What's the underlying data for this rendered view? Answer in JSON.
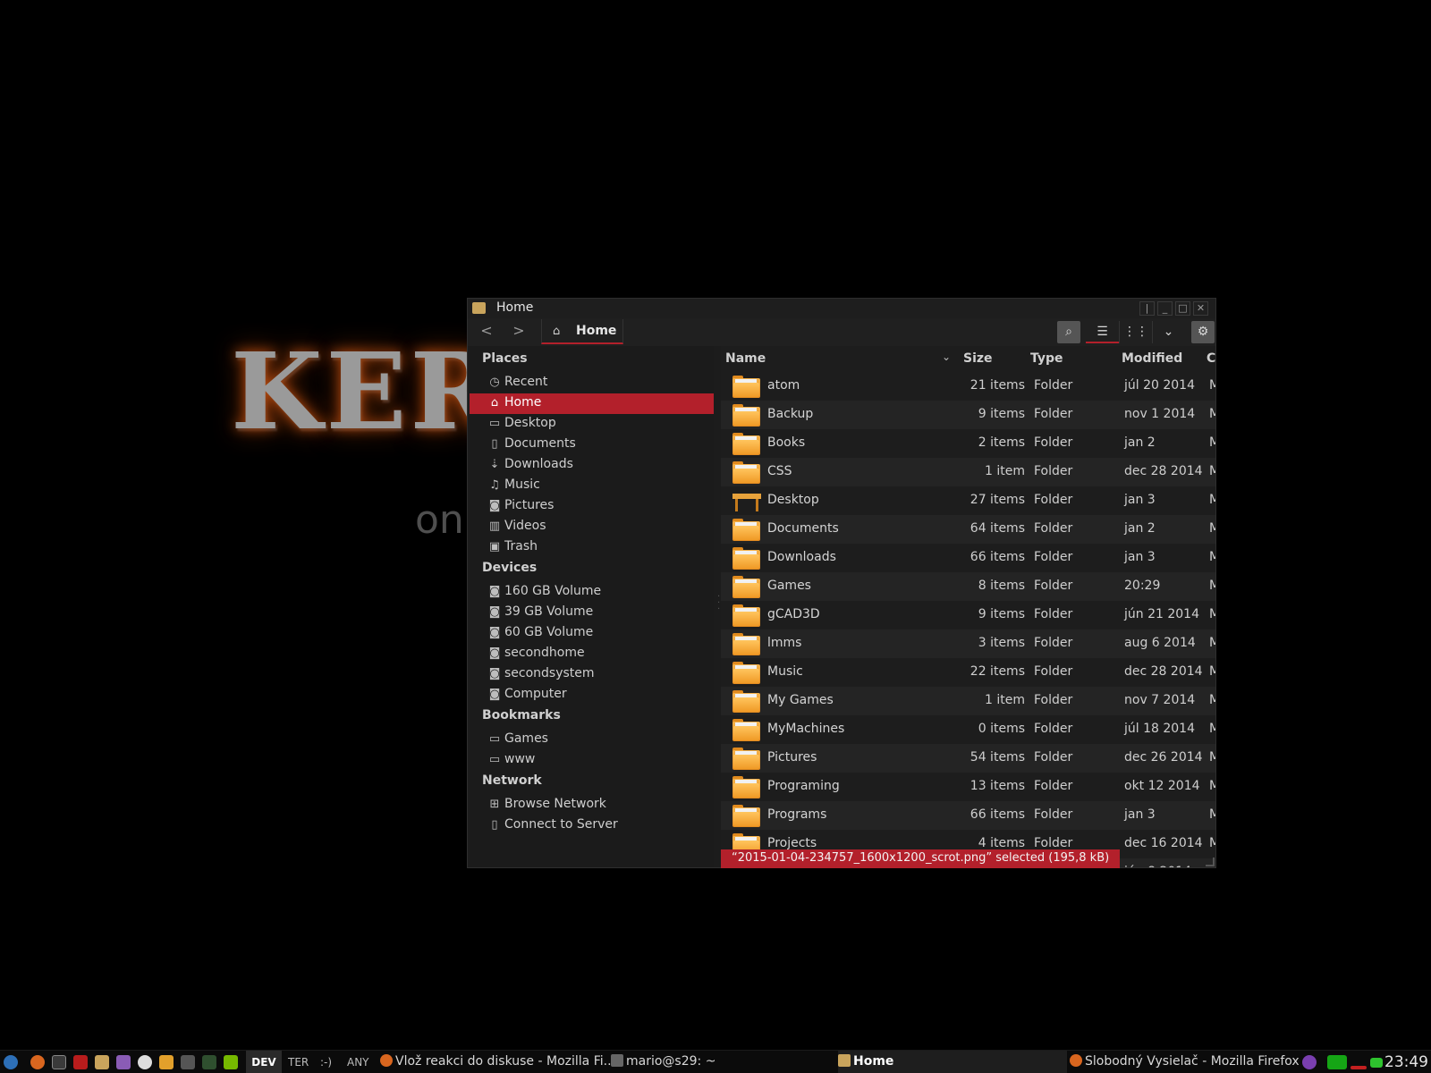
{
  "wallpaper": {
    "logo": "KER",
    "subtitle": "on"
  },
  "window": {
    "title": "Home",
    "controls": {
      "pin": "|",
      "minimize": "_",
      "maximize": "□",
      "close": "✕"
    }
  },
  "toolbar": {
    "back": "<",
    "forward": ">",
    "breadcrumb": {
      "icon": "home-icon",
      "label": "Home"
    },
    "search_glyph": "⌕",
    "list_glyph": "☰",
    "grid_glyph": "⋮⋮",
    "viewmenu_glyph": "⌄",
    "menu_glyph": "⚙"
  },
  "sidebar": {
    "places_label": "Places",
    "places": [
      {
        "icon": "clock-icon",
        "glyph": "◷",
        "label": "Recent"
      },
      {
        "icon": "home-icon",
        "glyph": "⌂",
        "label": "Home",
        "active": true
      },
      {
        "icon": "folder-icon",
        "glyph": "▭",
        "label": "Desktop"
      },
      {
        "icon": "document-icon",
        "glyph": "▯",
        "label": "Documents"
      },
      {
        "icon": "download-icon",
        "glyph": "⇣",
        "label": "Downloads"
      },
      {
        "icon": "music-icon",
        "glyph": "♫",
        "label": "Music"
      },
      {
        "icon": "camera-icon",
        "glyph": "◙",
        "label": "Pictures"
      },
      {
        "icon": "film-icon",
        "glyph": "▥",
        "label": "Videos"
      },
      {
        "icon": "trash-icon",
        "glyph": "▣",
        "label": "Trash"
      }
    ],
    "devices_label": "Devices",
    "devices": [
      {
        "icon": "drive-icon",
        "glyph": "◙",
        "label": "160 GB Volume"
      },
      {
        "icon": "drive-icon",
        "glyph": "◙",
        "label": "39 GB Volume"
      },
      {
        "icon": "drive-icon",
        "glyph": "◙",
        "label": "60 GB Volume"
      },
      {
        "icon": "drive-icon",
        "glyph": "◙",
        "label": "secondhome"
      },
      {
        "icon": "drive-icon",
        "glyph": "◙",
        "label": "secondsystem"
      },
      {
        "icon": "drive-icon",
        "glyph": "◙",
        "label": "Computer"
      }
    ],
    "bookmarks_label": "Bookmarks",
    "bookmarks": [
      {
        "icon": "folder-icon",
        "glyph": "▭",
        "label": "Games"
      },
      {
        "icon": "folder-icon",
        "glyph": "▭",
        "label": "www"
      }
    ],
    "network_label": "Network",
    "network": [
      {
        "icon": "network-icon",
        "glyph": "⊞",
        "label": "Browse Network"
      },
      {
        "icon": "server-icon",
        "glyph": "▯",
        "label": "Connect to Server"
      }
    ]
  },
  "files": {
    "columns": {
      "name": "Name",
      "size": "Size",
      "type": "Type",
      "modified": "Modified",
      "extra": "C"
    },
    "rows": [
      {
        "name": "atom",
        "size": "21 items",
        "type": "Folder",
        "modified": "júl 20 2014",
        "extra": "M"
      },
      {
        "name": "Backup",
        "size": "9 items",
        "type": "Folder",
        "modified": "nov 1 2014",
        "extra": "M"
      },
      {
        "name": "Books",
        "size": "2 items",
        "type": "Folder",
        "modified": "jan 2",
        "extra": "M"
      },
      {
        "name": "CSS",
        "size": "1 item",
        "type": "Folder",
        "modified": "dec 28 2014",
        "extra": "M"
      },
      {
        "name": "Desktop",
        "size": "27 items",
        "type": "Folder",
        "modified": "jan 3",
        "extra": "M",
        "icon": "desk"
      },
      {
        "name": "Documents",
        "size": "64 items",
        "type": "Folder",
        "modified": "jan 2",
        "extra": "M"
      },
      {
        "name": "Downloads",
        "size": "66 items",
        "type": "Folder",
        "modified": "jan 3",
        "extra": "M"
      },
      {
        "name": "Games",
        "size": "8 items",
        "type": "Folder",
        "modified": "20:29",
        "extra": "M"
      },
      {
        "name": "gCAD3D",
        "size": "9 items",
        "type": "Folder",
        "modified": "jún 21 2014",
        "extra": "M"
      },
      {
        "name": "lmms",
        "size": "3 items",
        "type": "Folder",
        "modified": "aug 6 2014",
        "extra": "M"
      },
      {
        "name": "Music",
        "size": "22 items",
        "type": "Folder",
        "modified": "dec 28 2014",
        "extra": "M"
      },
      {
        "name": "My Games",
        "size": "1 item",
        "type": "Folder",
        "modified": "nov 7 2014",
        "extra": "M"
      },
      {
        "name": "MyMachines",
        "size": "0 items",
        "type": "Folder",
        "modified": "júl 18 2014",
        "extra": "M"
      },
      {
        "name": "Pictures",
        "size": "54 items",
        "type": "Folder",
        "modified": "dec 26 2014",
        "extra": "M"
      },
      {
        "name": "Programing",
        "size": "13 items",
        "type": "Folder",
        "modified": "okt 12 2014",
        "extra": "M"
      },
      {
        "name": "Programs",
        "size": "66 items",
        "type": "Folder",
        "modified": "jan 3",
        "extra": "M"
      },
      {
        "name": "Projects",
        "size": "4 items",
        "type": "Folder",
        "modified": "dec 16 2014",
        "extra": "M"
      },
      {
        "name": "",
        "size": "",
        "type": "",
        "modified": "jún 8 2014",
        "extra": ""
      }
    ],
    "status": "“2015-01-04-234757_1600x1200_scrot.png” selected (195,8 kB)"
  },
  "taskbar": {
    "workspaces": [
      "DEV",
      "TER",
      ":-)",
      "ANY"
    ],
    "tasks": [
      {
        "label": "Vlož reakci do diskuse - Mozilla Fi...",
        "icon": "firefox-icon"
      },
      {
        "label": "mario@s29: ~",
        "icon": "terminal-icon"
      },
      {
        "label": "Home",
        "icon": "file-manager-icon",
        "active": true
      },
      {
        "label": "Slobodný Vysielač - Mozilla Firefox",
        "icon": "firefox-icon"
      }
    ],
    "clock": "23:49"
  },
  "colors": {
    "accent": "#b3202b",
    "folder": "#f0a030",
    "window_bg": "#1c1c1c"
  }
}
